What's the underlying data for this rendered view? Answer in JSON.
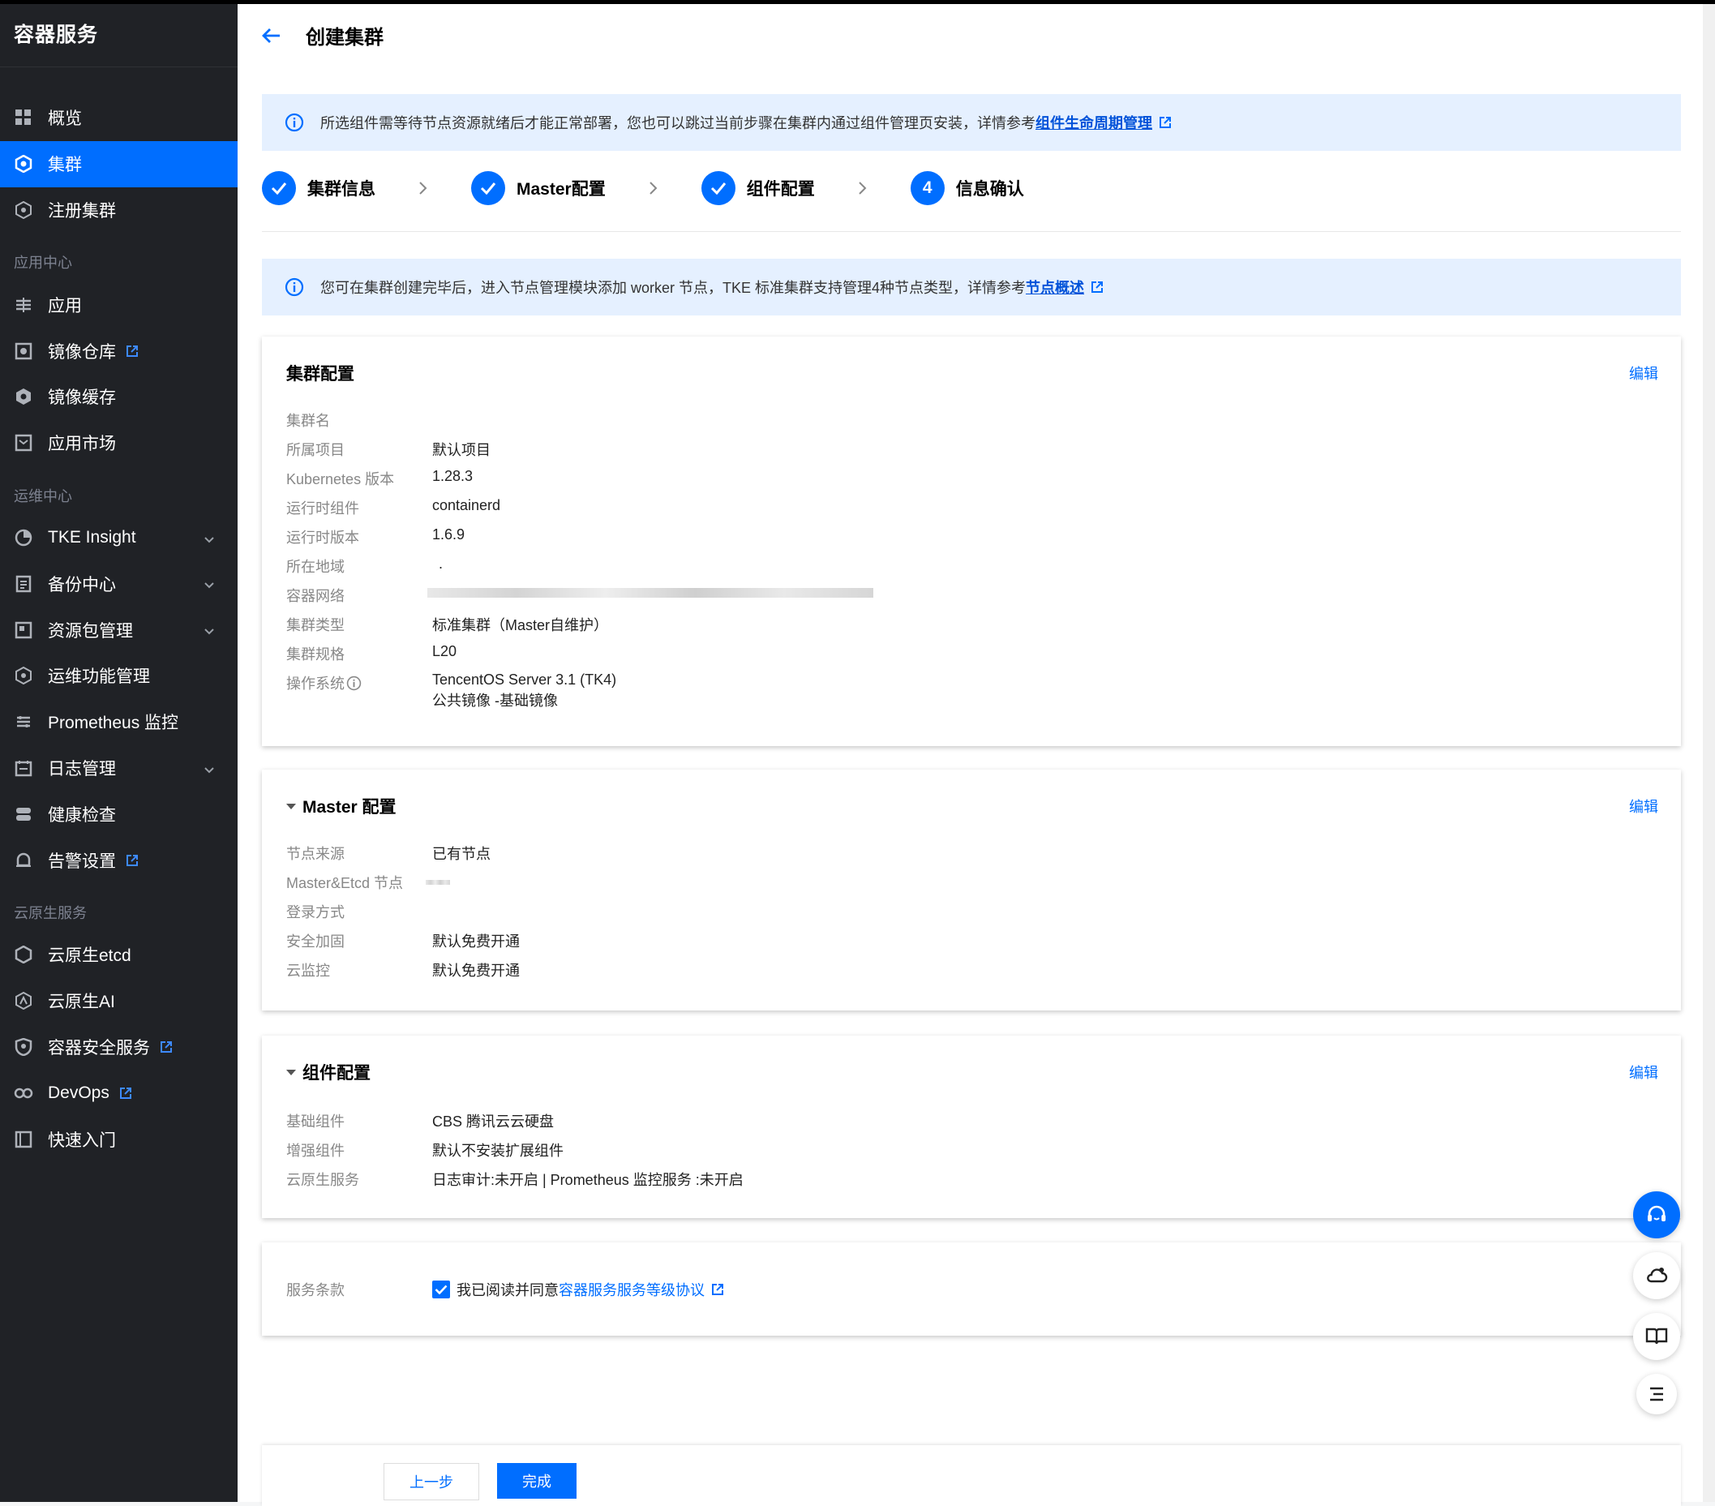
{
  "sidebar": {
    "title": "容器服务",
    "items": [
      {
        "label": "概览",
        "icon": "grid-icon"
      },
      {
        "label": "集群",
        "icon": "cluster-icon",
        "active": true
      },
      {
        "label": "注册集群",
        "icon": "register-cluster-icon"
      }
    ],
    "group_app": "应用中心",
    "app_items": [
      {
        "label": "应用",
        "icon": "app-icon"
      },
      {
        "label": "镜像仓库",
        "icon": "image-repo-icon",
        "external": true
      },
      {
        "label": "镜像缓存",
        "icon": "image-cache-icon"
      },
      {
        "label": "应用市场",
        "icon": "app-market-icon"
      }
    ],
    "group_ops": "运维中心",
    "ops_items": [
      {
        "label": "TKE Insight",
        "icon": "insight-icon",
        "expand": true
      },
      {
        "label": "备份中心",
        "icon": "backup-icon",
        "expand": true
      },
      {
        "label": "资源包管理",
        "icon": "resource-pack-icon",
        "expand": true
      },
      {
        "label": "运维功能管理",
        "icon": "ops-feature-icon"
      },
      {
        "label": "Prometheus 监控",
        "icon": "prometheus-icon"
      },
      {
        "label": "日志管理",
        "icon": "log-icon",
        "expand": true
      },
      {
        "label": "健康检查",
        "icon": "health-check-icon"
      },
      {
        "label": "告警设置",
        "icon": "alarm-icon",
        "external": true
      }
    ],
    "group_cloud": "云原生服务",
    "cloud_items": [
      {
        "label": "云原生etcd",
        "icon": "etcd-icon"
      },
      {
        "label": "云原生AI",
        "icon": "ai-icon"
      },
      {
        "label": "容器安全服务",
        "icon": "security-icon",
        "external": true
      },
      {
        "label": "DevOps",
        "icon": "devops-icon",
        "external": true
      },
      {
        "label": "快速入门",
        "icon": "quickstart-icon"
      }
    ]
  },
  "header": {
    "title": "创建集群"
  },
  "alert_top": {
    "text": "所选组件需等待节点资源就绪后才能正常部署，您也可以跳过当前步骤在集群内通过组件管理页安装，详情参考",
    "link": "组件生命周期管理"
  },
  "steps": [
    {
      "label": "集群信息",
      "done": true
    },
    {
      "label": "Master配置",
      "done": true
    },
    {
      "label": "组件配置",
      "done": true
    },
    {
      "label": "信息确认",
      "number": "4"
    }
  ],
  "alert_node": {
    "text": "您可在集群创建完毕后，进入节点管理模块添加 worker 节点，TKE 标准集群支持管理4种节点类型，详情参考",
    "link": "节点概述"
  },
  "cluster_config": {
    "title": "集群配置",
    "edit": "编辑",
    "rows": [
      {
        "k": "集群名",
        "v": ""
      },
      {
        "k": "所属项目",
        "v": "默认项目"
      },
      {
        "k": "Kubernetes 版本",
        "v": "1.28.3"
      },
      {
        "k": "运行时组件",
        "v": "containerd"
      },
      {
        "k": "运行时版本",
        "v": "1.6.9"
      },
      {
        "k": "所在地域",
        "v": "."
      },
      {
        "k": "容器网络",
        "v": ""
      },
      {
        "k": "集群类型",
        "v": "标准集群（Master自维护）"
      },
      {
        "k": "集群规格",
        "v": "L20"
      }
    ],
    "os_label": "操作系统",
    "os_value": "TencentOS Server 3.1 (TK4)",
    "os_image": "公共镜像 -基础镜像"
  },
  "master_config": {
    "title": "Master 配置",
    "edit": "编辑",
    "rows": [
      {
        "k": "节点来源",
        "v": "已有节点"
      },
      {
        "k": "Master&Etcd 节点",
        "v": ""
      },
      {
        "k": "登录方式",
        "v": ""
      },
      {
        "k": "安全加固",
        "v": "默认免费开通"
      },
      {
        "k": "云监控",
        "v": "默认免费开通"
      }
    ]
  },
  "component_config": {
    "title": "组件配置",
    "edit": "编辑",
    "rows": [
      {
        "k": "基础组件",
        "v": "CBS 腾讯云云硬盘"
      },
      {
        "k": "增强组件",
        "v": "默认不安装扩展组件"
      },
      {
        "k": "云原生服务",
        "v": "日志审计:未开启 | Prometheus 监控服务 :未开启"
      }
    ]
  },
  "terms": {
    "label": "服务条款",
    "text": "我已阅读并同意",
    "link": "容器服务服务等级协议"
  },
  "footer": {
    "prev": "上一步",
    "done": "完成"
  },
  "colors": {
    "primary": "#006eff",
    "sidebar_bg": "#202226",
    "alert_bg": "#e5f0ff"
  }
}
